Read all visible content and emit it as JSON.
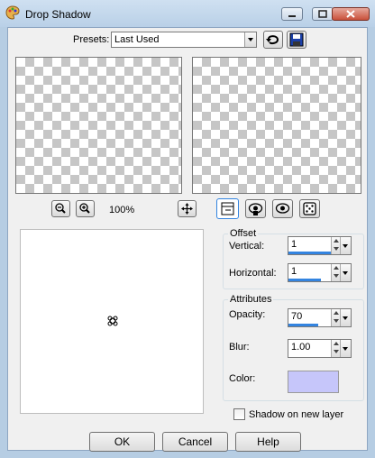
{
  "window": {
    "title": "Drop Shadow",
    "app_icon": "paint-palette-icon",
    "controls": [
      "minimize-icon",
      "maximize-icon",
      "close-icon"
    ]
  },
  "presets": {
    "label": "Presets:",
    "value": "Last Used",
    "buttons": [
      "reset-icon",
      "save-icon"
    ]
  },
  "preview": {
    "zoom_out_icon": "zoom-out-icon",
    "zoom_in_icon": "zoom-in-icon",
    "zoom_level": "100%",
    "pan_icon": "move-icon",
    "tool_icons": [
      "preview-toggle-icon",
      "proof-icon",
      "auto-proof-icon",
      "randomize-icon"
    ],
    "target_icon": "crosshair-icon"
  },
  "offset": {
    "legend": "Offset",
    "vertical_label": "Vertical:",
    "vertical_value": "1",
    "horizontal_label": "Horizontal:",
    "horizontal_value": "1"
  },
  "attributes": {
    "legend": "Attributes",
    "opacity_label": "Opacity:",
    "opacity_value": "70",
    "blur_label": "Blur:",
    "blur_value": "1.00",
    "color_label": "Color:",
    "color_swatch": "#c6c6fa"
  },
  "shadow_new_layer": {
    "label": "Shadow on new layer",
    "checked": false
  },
  "buttons": {
    "ok": "OK",
    "cancel": "Cancel",
    "help": "Help"
  },
  "colors": {
    "accent": "#3384e0"
  }
}
